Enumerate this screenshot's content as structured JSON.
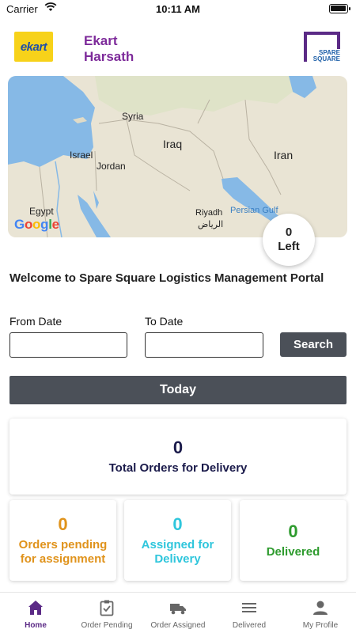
{
  "status": {
    "carrier": "Carrier",
    "time": "10:11 AM",
    "battery_level": 0.9
  },
  "header": {
    "ekart_logo_text": "ekart",
    "title_line1": "Ekart",
    "title_line2": "Harsath",
    "spare_logo_line1": "SPARE",
    "spare_logo_line2": "SQUARE"
  },
  "map": {
    "labels": {
      "syria": "Syria",
      "iraq": "Iraq",
      "israel": "Israel",
      "jordan": "Jordan",
      "iran": "Iran",
      "egypt": "Egypt",
      "riyadh": "Riyadh",
      "riyadh_ar": "الرياض",
      "persian_gulf": "Persian Gulf"
    },
    "attribution": "Google"
  },
  "left_badge": {
    "count": "0",
    "label": "Left"
  },
  "welcome_text": "Welcome to Spare Square Logistics Management Portal",
  "filters": {
    "from_label": "From Date",
    "to_label": "To Date",
    "from_value": "",
    "to_value": "",
    "search_label": "Search"
  },
  "today_label": "Today",
  "stats": {
    "total": {
      "value": "0",
      "label": "Total Orders for Delivery",
      "color": "#1b1b4b"
    },
    "pending": {
      "value": "0",
      "label_line1": "Orders pending",
      "label_line2": "for assignment",
      "color": "#e0931c"
    },
    "assigned": {
      "value": "0",
      "label_line1": "Assigned for",
      "label_line2": "Delivery",
      "color": "#2fc6dc"
    },
    "delivered": {
      "value": "0",
      "label": "Delivered",
      "color": "#2e9b2e"
    }
  },
  "tabs": [
    {
      "label": "Home",
      "icon": "home-icon",
      "active": true
    },
    {
      "label": "Order Pending",
      "icon": "clipboard-check-icon",
      "active": false
    },
    {
      "label": "Order Assigned",
      "icon": "truck-icon",
      "active": false
    },
    {
      "label": "Delivered",
      "icon": "list-icon",
      "active": false
    },
    {
      "label": "My Profile",
      "icon": "person-icon",
      "active": false
    }
  ],
  "colors": {
    "accent": "#5b2a86",
    "button": "#4b5058",
    "title": "#7d2a9a"
  }
}
